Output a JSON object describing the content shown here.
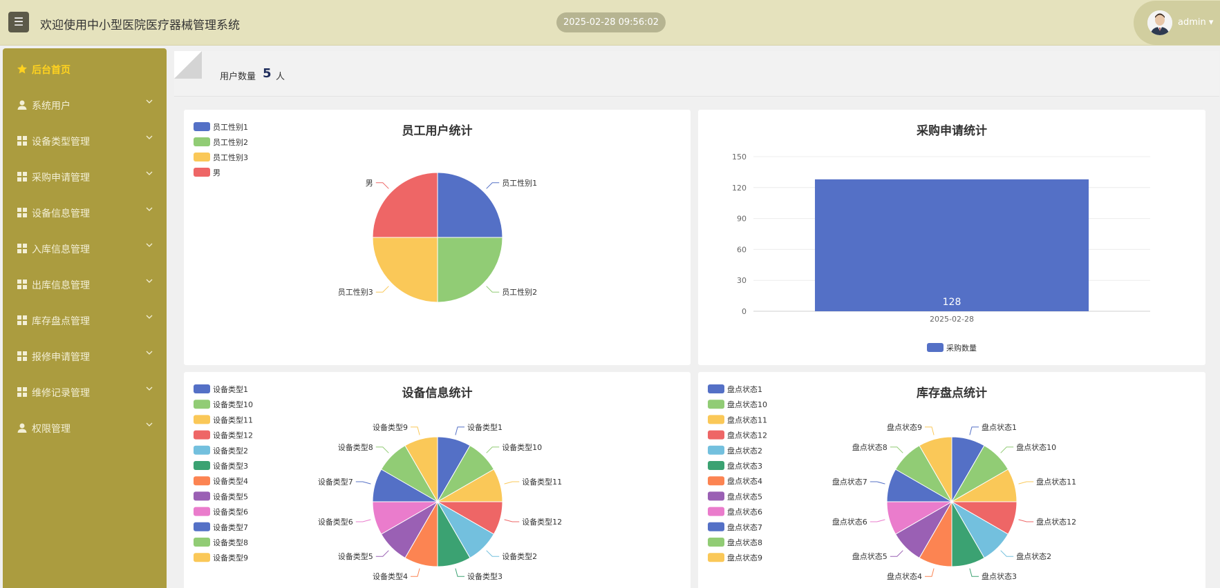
{
  "header": {
    "title": "欢迎使用中小型医院医疗器械管理系统",
    "datetime": "2025-02-28 09:56:02",
    "user": "admin"
  },
  "sidebar": {
    "items": [
      {
        "label": "后台首页",
        "icon": "home-icon",
        "active": true,
        "expandable": false
      },
      {
        "label": "系统用户",
        "icon": "user-icon",
        "active": false,
        "expandable": true
      },
      {
        "label": "设备类型管理",
        "icon": "grid-icon",
        "active": false,
        "expandable": true
      },
      {
        "label": "采购申请管理",
        "icon": "grid-icon",
        "active": false,
        "expandable": true
      },
      {
        "label": "设备信息管理",
        "icon": "grid-icon",
        "active": false,
        "expandable": true
      },
      {
        "label": "入库信息管理",
        "icon": "grid-icon",
        "active": false,
        "expandable": true
      },
      {
        "label": "出库信息管理",
        "icon": "grid-icon",
        "active": false,
        "expandable": true
      },
      {
        "label": "库存盘点管理",
        "icon": "grid-icon",
        "active": false,
        "expandable": true
      },
      {
        "label": "报修申请管理",
        "icon": "grid-icon",
        "active": false,
        "expandable": true
      },
      {
        "label": "维修记录管理",
        "icon": "grid-icon",
        "active": false,
        "expandable": true
      },
      {
        "label": "权限管理",
        "icon": "user-icon",
        "active": false,
        "expandable": true
      }
    ]
  },
  "stats": {
    "label": "用户数量",
    "value": "5",
    "unit": "人"
  },
  "palette": [
    "#5470c6",
    "#91cc75",
    "#fac858",
    "#ee6666",
    "#73c0de",
    "#3ba272",
    "#fc8452",
    "#9a60b4",
    "#ea7ccc"
  ],
  "chart_data": [
    {
      "type": "pie",
      "title": "员工用户统计",
      "categories": [
        "员工性别1",
        "员工性别2",
        "员工性别3",
        "男"
      ],
      "values": [
        1,
        1,
        1,
        1
      ],
      "legend": "top-left"
    },
    {
      "type": "bar",
      "title": "采购申请统计",
      "categories": [
        "2025-02-28"
      ],
      "series": [
        {
          "name": "采购数量",
          "values": [
            128
          ]
        }
      ],
      "ylim": [
        0,
        150
      ],
      "yticks": [
        0,
        30,
        60,
        90,
        120,
        150
      ],
      "grid": true,
      "legend": "bottom"
    },
    {
      "type": "pie",
      "title": "设备信息统计",
      "categories": [
        "设备类型1",
        "设备类型10",
        "设备类型11",
        "设备类型12",
        "设备类型2",
        "设备类型3",
        "设备类型4",
        "设备类型5",
        "设备类型6",
        "设备类型7",
        "设备类型8",
        "设备类型9"
      ],
      "values": [
        1,
        1,
        1,
        1,
        1,
        1,
        1,
        1,
        1,
        1,
        1,
        1
      ],
      "legend": "top-left"
    },
    {
      "type": "pie",
      "title": "库存盘点统计",
      "categories": [
        "盘点状态1",
        "盘点状态10",
        "盘点状态11",
        "盘点状态12",
        "盘点状态2",
        "盘点状态3",
        "盘点状态4",
        "盘点状态5",
        "盘点状态6",
        "盘点状态7",
        "盘点状态8",
        "盘点状态9"
      ],
      "values": [
        1,
        1,
        1,
        1,
        1,
        1,
        1,
        1,
        1,
        1,
        1,
        1
      ],
      "legend": "top-left"
    }
  ]
}
